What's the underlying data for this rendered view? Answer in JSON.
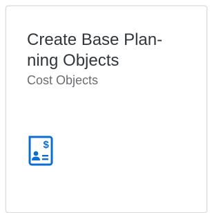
{
  "tile": {
    "title": "Create Base Plan-ning Objects",
    "title_line1": "Create Base Plan-",
    "title_line2": "ning Objects",
    "subtitle": "Cost Objects",
    "icon": "cost-document-icon",
    "colors": {
      "icon": "#0a6ed1",
      "title": "#32363a",
      "subtitle": "#6a6d70",
      "border": "#d9d9d9"
    }
  }
}
